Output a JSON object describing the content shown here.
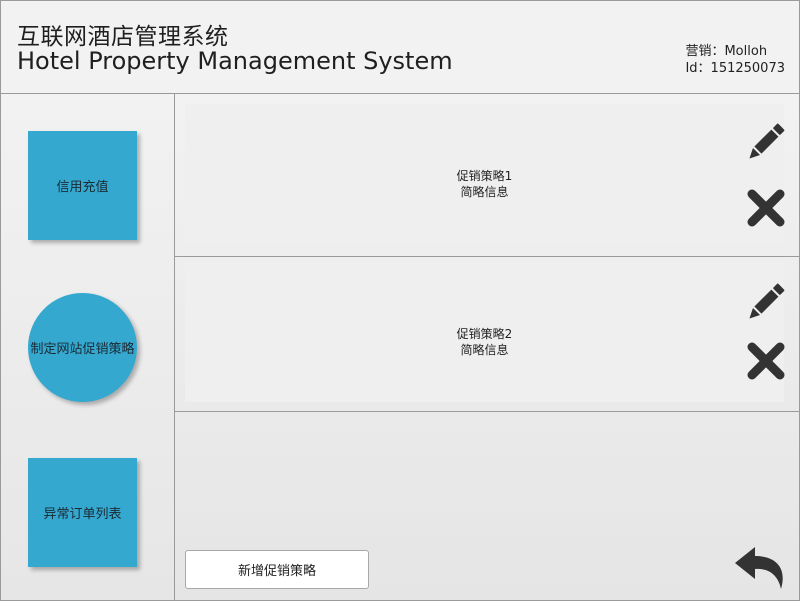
{
  "header": {
    "title_cn": "互联网酒店管理系统",
    "title_en": "Hotel Property Management System",
    "user_label": "营销：Molloh",
    "user_id": "Id：151250073"
  },
  "sidebar": {
    "items": [
      {
        "label": "信用充值"
      },
      {
        "label": "制定网站促销策略"
      },
      {
        "label": "异常订单列表"
      }
    ]
  },
  "strategies": [
    {
      "name": "促销策略1",
      "summary": "简略信息"
    },
    {
      "name": "促销策略2",
      "summary": "简略信息"
    }
  ],
  "actions": {
    "add_label": "新增促销策略"
  },
  "icons": {
    "edit": "pencil-icon",
    "delete": "close-icon",
    "back": "undo-arrow-icon"
  },
  "colors": {
    "nav_button": "#35a8d0",
    "icon": "#333333",
    "background": "#f2f2f2"
  }
}
